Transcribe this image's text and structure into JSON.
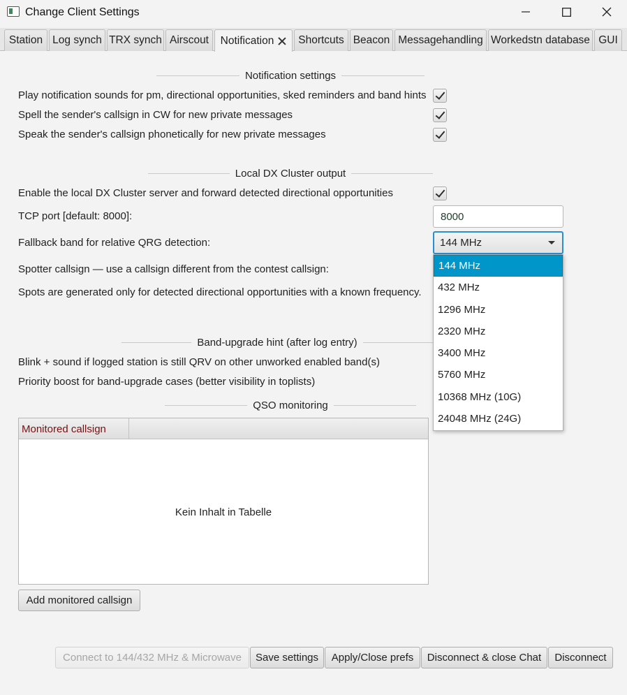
{
  "window": {
    "title": "Change Client Settings"
  },
  "tabs": [
    {
      "label": "Station"
    },
    {
      "label": "Log synch"
    },
    {
      "label": "TRX synch"
    },
    {
      "label": "Airscout"
    },
    {
      "label": "Notification",
      "active": true
    },
    {
      "label": "Shortcuts"
    },
    {
      "label": "Beacon"
    },
    {
      "label": "Messagehandling"
    },
    {
      "label": "Workedstn database"
    },
    {
      "label": "GUI"
    }
  ],
  "notification": {
    "heading": "Notification settings",
    "play_sounds_label": "Play notification sounds for pm, directional opportunities, sked reminders and band hints",
    "play_sounds_checked": true,
    "spell_cw_label": "Spell the sender's callsign in CW for new private messages",
    "spell_cw_checked": true,
    "speak_phonetic_label": "Speak the sender's callsign phonetically for new private messages",
    "speak_phonetic_checked": true
  },
  "dx_cluster": {
    "heading": "Local DX Cluster output",
    "enable_label": "Enable the local DX Cluster server and forward detected directional opportunities",
    "enable_checked": true,
    "tcp_port_label": "TCP port [default: 8000]:",
    "tcp_port_value": "8000",
    "fallback_band_label": "Fallback band for relative QRG detection:",
    "fallback_band_value": "144 MHz",
    "fallback_band_options": [
      "144 MHz",
      "432 MHz",
      "1296 MHz",
      "2320 MHz",
      "3400 MHz",
      "5760 MHz",
      "10368 MHz (10G)",
      "24048 MHz (24G)"
    ],
    "spotter_label": "Spotter callsign — use a callsign different from the contest callsign:",
    "spots_note": "Spots are generated only for detected directional opportunities with a known frequency."
  },
  "band_upgrade": {
    "heading": "Band-upgrade hint (after log entry)",
    "blink_label": "Blink + sound if logged station is still QRV on other unworked enabled band(s)",
    "priority_label": "Priority boost for band-upgrade cases (better visibility in toplists)"
  },
  "qso_monitoring": {
    "heading": "QSO monitoring",
    "column_header": "Monitored callsign",
    "empty_text": "Kein Inhalt in Tabelle",
    "add_button": "Add monitored callsign"
  },
  "footer": {
    "connect_button": "Connect to 144/432 MHz & Microwave",
    "save_button": "Save settings",
    "apply_button": "Apply/Close prefs",
    "disconnect_close_button": "Disconnect & close Chat",
    "disconnect_button": "Disconnect"
  },
  "colors": {
    "accent": "#2a8fd0",
    "selection": "#0096c9",
    "column_header_text": "#7a1010"
  }
}
